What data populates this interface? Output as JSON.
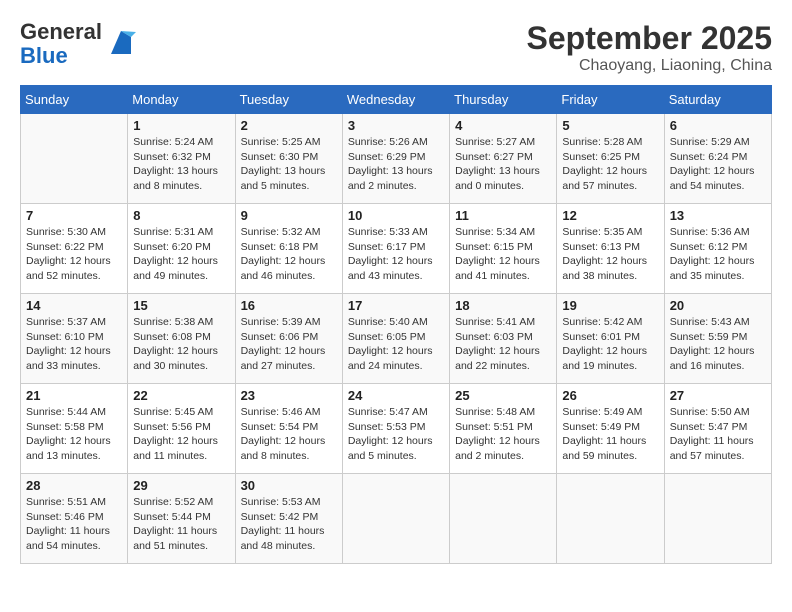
{
  "header": {
    "logo_line1": "General",
    "logo_line2": "Blue",
    "month": "September 2025",
    "location": "Chaoyang, Liaoning, China"
  },
  "days_of_week": [
    "Sunday",
    "Monday",
    "Tuesday",
    "Wednesday",
    "Thursday",
    "Friday",
    "Saturday"
  ],
  "weeks": [
    [
      {
        "day": "",
        "info": ""
      },
      {
        "day": "1",
        "info": "Sunrise: 5:24 AM\nSunset: 6:32 PM\nDaylight: 13 hours\nand 8 minutes."
      },
      {
        "day": "2",
        "info": "Sunrise: 5:25 AM\nSunset: 6:30 PM\nDaylight: 13 hours\nand 5 minutes."
      },
      {
        "day": "3",
        "info": "Sunrise: 5:26 AM\nSunset: 6:29 PM\nDaylight: 13 hours\nand 2 minutes."
      },
      {
        "day": "4",
        "info": "Sunrise: 5:27 AM\nSunset: 6:27 PM\nDaylight: 13 hours\nand 0 minutes."
      },
      {
        "day": "5",
        "info": "Sunrise: 5:28 AM\nSunset: 6:25 PM\nDaylight: 12 hours\nand 57 minutes."
      },
      {
        "day": "6",
        "info": "Sunrise: 5:29 AM\nSunset: 6:24 PM\nDaylight: 12 hours\nand 54 minutes."
      }
    ],
    [
      {
        "day": "7",
        "info": "Sunrise: 5:30 AM\nSunset: 6:22 PM\nDaylight: 12 hours\nand 52 minutes."
      },
      {
        "day": "8",
        "info": "Sunrise: 5:31 AM\nSunset: 6:20 PM\nDaylight: 12 hours\nand 49 minutes."
      },
      {
        "day": "9",
        "info": "Sunrise: 5:32 AM\nSunset: 6:18 PM\nDaylight: 12 hours\nand 46 minutes."
      },
      {
        "day": "10",
        "info": "Sunrise: 5:33 AM\nSunset: 6:17 PM\nDaylight: 12 hours\nand 43 minutes."
      },
      {
        "day": "11",
        "info": "Sunrise: 5:34 AM\nSunset: 6:15 PM\nDaylight: 12 hours\nand 41 minutes."
      },
      {
        "day": "12",
        "info": "Sunrise: 5:35 AM\nSunset: 6:13 PM\nDaylight: 12 hours\nand 38 minutes."
      },
      {
        "day": "13",
        "info": "Sunrise: 5:36 AM\nSunset: 6:12 PM\nDaylight: 12 hours\nand 35 minutes."
      }
    ],
    [
      {
        "day": "14",
        "info": "Sunrise: 5:37 AM\nSunset: 6:10 PM\nDaylight: 12 hours\nand 33 minutes."
      },
      {
        "day": "15",
        "info": "Sunrise: 5:38 AM\nSunset: 6:08 PM\nDaylight: 12 hours\nand 30 minutes."
      },
      {
        "day": "16",
        "info": "Sunrise: 5:39 AM\nSunset: 6:06 PM\nDaylight: 12 hours\nand 27 minutes."
      },
      {
        "day": "17",
        "info": "Sunrise: 5:40 AM\nSunset: 6:05 PM\nDaylight: 12 hours\nand 24 minutes."
      },
      {
        "day": "18",
        "info": "Sunrise: 5:41 AM\nSunset: 6:03 PM\nDaylight: 12 hours\nand 22 minutes."
      },
      {
        "day": "19",
        "info": "Sunrise: 5:42 AM\nSunset: 6:01 PM\nDaylight: 12 hours\nand 19 minutes."
      },
      {
        "day": "20",
        "info": "Sunrise: 5:43 AM\nSunset: 5:59 PM\nDaylight: 12 hours\nand 16 minutes."
      }
    ],
    [
      {
        "day": "21",
        "info": "Sunrise: 5:44 AM\nSunset: 5:58 PM\nDaylight: 12 hours\nand 13 minutes."
      },
      {
        "day": "22",
        "info": "Sunrise: 5:45 AM\nSunset: 5:56 PM\nDaylight: 12 hours\nand 11 minutes."
      },
      {
        "day": "23",
        "info": "Sunrise: 5:46 AM\nSunset: 5:54 PM\nDaylight: 12 hours\nand 8 minutes."
      },
      {
        "day": "24",
        "info": "Sunrise: 5:47 AM\nSunset: 5:53 PM\nDaylight: 12 hours\nand 5 minutes."
      },
      {
        "day": "25",
        "info": "Sunrise: 5:48 AM\nSunset: 5:51 PM\nDaylight: 12 hours\nand 2 minutes."
      },
      {
        "day": "26",
        "info": "Sunrise: 5:49 AM\nSunset: 5:49 PM\nDaylight: 11 hours\nand 59 minutes."
      },
      {
        "day": "27",
        "info": "Sunrise: 5:50 AM\nSunset: 5:47 PM\nDaylight: 11 hours\nand 57 minutes."
      }
    ],
    [
      {
        "day": "28",
        "info": "Sunrise: 5:51 AM\nSunset: 5:46 PM\nDaylight: 11 hours\nand 54 minutes."
      },
      {
        "day": "29",
        "info": "Sunrise: 5:52 AM\nSunset: 5:44 PM\nDaylight: 11 hours\nand 51 minutes."
      },
      {
        "day": "30",
        "info": "Sunrise: 5:53 AM\nSunset: 5:42 PM\nDaylight: 11 hours\nand 48 minutes."
      },
      {
        "day": "",
        "info": ""
      },
      {
        "day": "",
        "info": ""
      },
      {
        "day": "",
        "info": ""
      },
      {
        "day": "",
        "info": ""
      }
    ]
  ]
}
